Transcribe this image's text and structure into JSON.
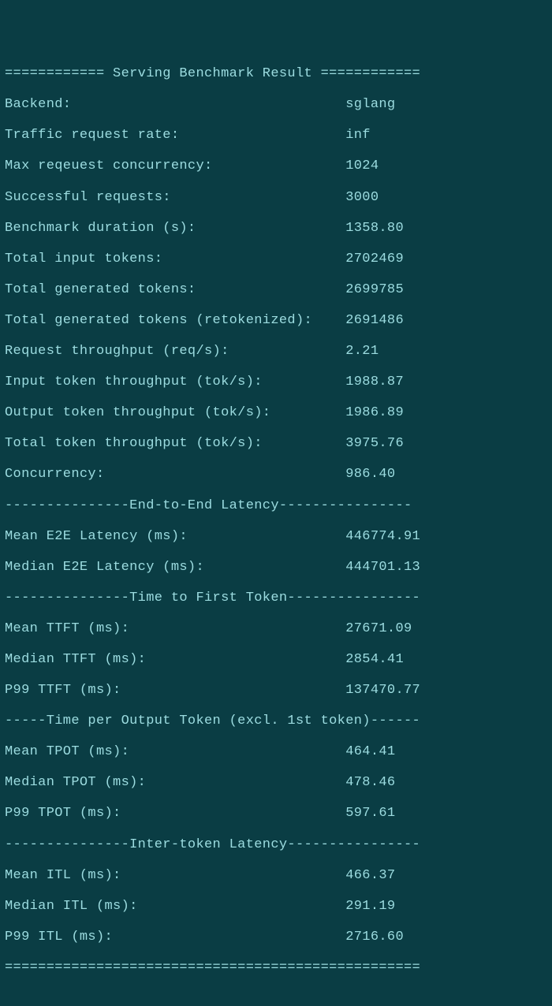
{
  "title_line": "============ Serving Benchmark Result ============",
  "stats": [
    {
      "label": "Backend:",
      "value": "sglang"
    },
    {
      "label": "Traffic request rate:",
      "value": "inf"
    },
    {
      "label": "Max reqeuest concurrency:",
      "value": "1024"
    },
    {
      "label": "Successful requests:",
      "value": "3000"
    },
    {
      "label": "Benchmark duration (s):",
      "value": "1358.80"
    },
    {
      "label": "Total input tokens:",
      "value": "2702469"
    },
    {
      "label": "Total generated tokens:",
      "value": "2699785"
    },
    {
      "label": "Total generated tokens (retokenized):",
      "value": "2691486"
    },
    {
      "label": "Request throughput (req/s):",
      "value": "2.21"
    },
    {
      "label": "Input token throughput (tok/s):",
      "value": "1988.87"
    },
    {
      "label": "Output token throughput (tok/s):",
      "value": "1986.89"
    },
    {
      "label": "Total token throughput (tok/s):",
      "value": "3975.76"
    },
    {
      "label": "Concurrency:",
      "value": "986.40"
    }
  ],
  "sections": [
    {
      "header": "---------------End-to-End Latency----------------",
      "rows": [
        {
          "label": "Mean E2E Latency (ms):",
          "value": "446774.91"
        },
        {
          "label": "Median E2E Latency (ms):",
          "value": "444701.13"
        }
      ]
    },
    {
      "header": "---------------Time to First Token----------------",
      "rows": [
        {
          "label": "Mean TTFT (ms):",
          "value": "27671.09"
        },
        {
          "label": "Median TTFT (ms):",
          "value": "2854.41"
        },
        {
          "label": "P99 TTFT (ms):",
          "value": "137470.77"
        }
      ]
    },
    {
      "header": "-----Time per Output Token (excl. 1st token)------",
      "rows": [
        {
          "label": "Mean TPOT (ms):",
          "value": "464.41"
        },
        {
          "label": "Median TPOT (ms):",
          "value": "478.46"
        },
        {
          "label": "P99 TPOT (ms):",
          "value": "597.61"
        }
      ]
    },
    {
      "header": "---------------Inter-token Latency----------------",
      "rows": [
        {
          "label": "Mean ITL (ms):",
          "value": "466.37"
        },
        {
          "label": "Median ITL (ms):",
          "value": "291.19"
        },
        {
          "label": "P99 ITL (ms):",
          "value": "2716.60"
        }
      ]
    }
  ],
  "footer_line": "==================================================",
  "label_width": 41,
  "lw_overrides": {
    "1.0.label": 41
  }
}
